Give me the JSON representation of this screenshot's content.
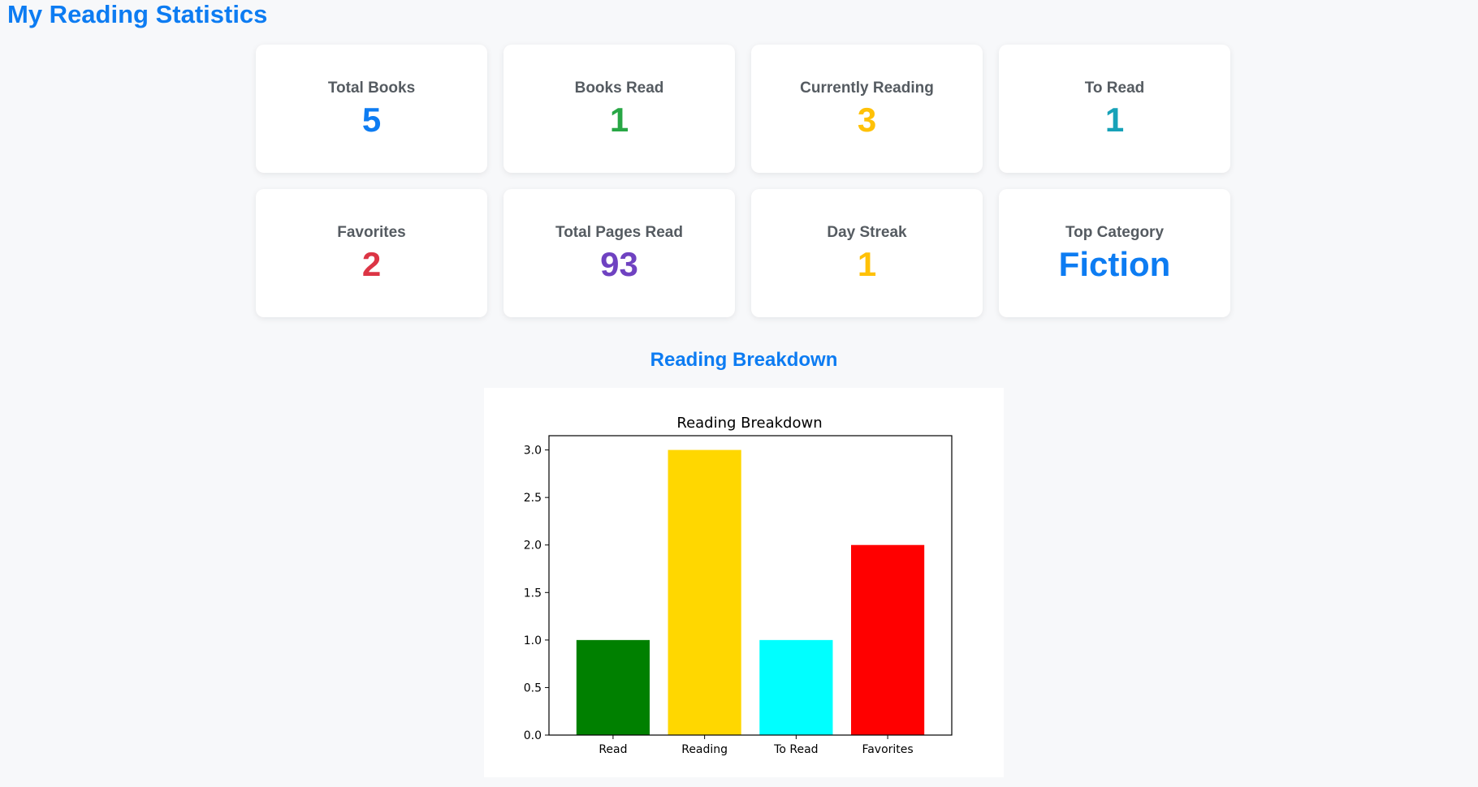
{
  "page": {
    "title": "My Reading Statistics"
  },
  "stats": [
    {
      "label": "Total Books",
      "value": "5",
      "color": "#0d7cf2"
    },
    {
      "label": "Books Read",
      "value": "1",
      "color": "#28a745"
    },
    {
      "label": "Currently Reading",
      "value": "3",
      "color": "#ffc107"
    },
    {
      "label": "To Read",
      "value": "1",
      "color": "#17a2b8"
    },
    {
      "label": "Favorites",
      "value": "2",
      "color": "#dc3545"
    },
    {
      "label": "Total Pages Read",
      "value": "93",
      "color": "#6f42c1"
    },
    {
      "label": "Day Streak",
      "value": "1",
      "color": "#ffc107"
    },
    {
      "label": "Top Category",
      "value": "Fiction",
      "color": "#0d7cf2"
    }
  ],
  "breakdown": {
    "heading": "Reading Breakdown"
  },
  "chart_data": {
    "type": "bar",
    "title": "Reading Breakdown",
    "categories": [
      "Read",
      "Reading",
      "To Read",
      "Favorites"
    ],
    "values": [
      1,
      3,
      1,
      2
    ],
    "colors": [
      "#008000",
      "#ffd700",
      "#00ffff",
      "#ff0000"
    ],
    "xlabel": "",
    "ylabel": "",
    "ylim": [
      0,
      3.15
    ],
    "yticks": [
      "0.0",
      "0.5",
      "1.0",
      "1.5",
      "2.0",
      "2.5",
      "3.0"
    ],
    "grid": false
  }
}
